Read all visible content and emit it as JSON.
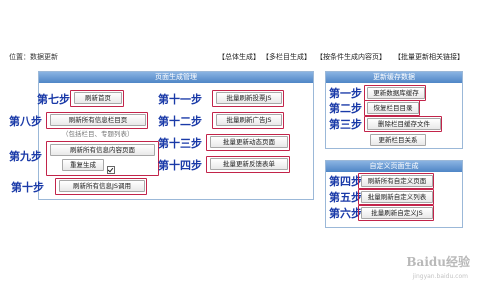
{
  "location": "位置：数据更新",
  "top_links": [
    "【总体生成】",
    "【多栏目生成】",
    "【按条件生成内容页】",
    "【批量更新相关链接】"
  ],
  "panels": {
    "page_gen": {
      "title": "页面生成管理"
    },
    "cache": {
      "title": "更新缓存数据"
    },
    "custom": {
      "title": "自定义页面生成"
    }
  },
  "steps": [
    {
      "step": "第七步",
      "button": "刷新首页"
    },
    {
      "step": "第八步",
      "button": "刷新所有信息栏目页"
    },
    {
      "step": "第九步",
      "button": "刷新所有信息内容页面"
    },
    {
      "step": "第十步",
      "button": "刷新所有信息JS调用"
    },
    {
      "step": "第十一步",
      "button": "批量刷新投票JS"
    },
    {
      "step": "第十二步",
      "button": "批量刷新广告JS"
    },
    {
      "step": "第十三步",
      "button": "批量更新动态页面"
    },
    {
      "step": "第十四步",
      "button": "批量更新反馈表单"
    },
    {
      "step": "第一步",
      "button": "更新数据库缓存"
    },
    {
      "step": "第二步",
      "button": "恢复栏目目录"
    },
    {
      "step": "第三步",
      "button": "删除栏目缓存文件"
    },
    {
      "step": "第四步",
      "button": "刷新所有自定义页面"
    },
    {
      "step": "第五步",
      "button": "批量刷新自定义列表"
    },
    {
      "step": "第六步",
      "button": "批量刷新自定义JS"
    }
  ],
  "extra": {
    "hidden_hint": "（包括栏目、专题列表）",
    "duplicate_button": "重复生成",
    "duplicate_checked": true,
    "column_relation": "更新栏目关系"
  },
  "watermark": {
    "logo": "Baidu经验",
    "url": "jingyan.baidu.com"
  }
}
